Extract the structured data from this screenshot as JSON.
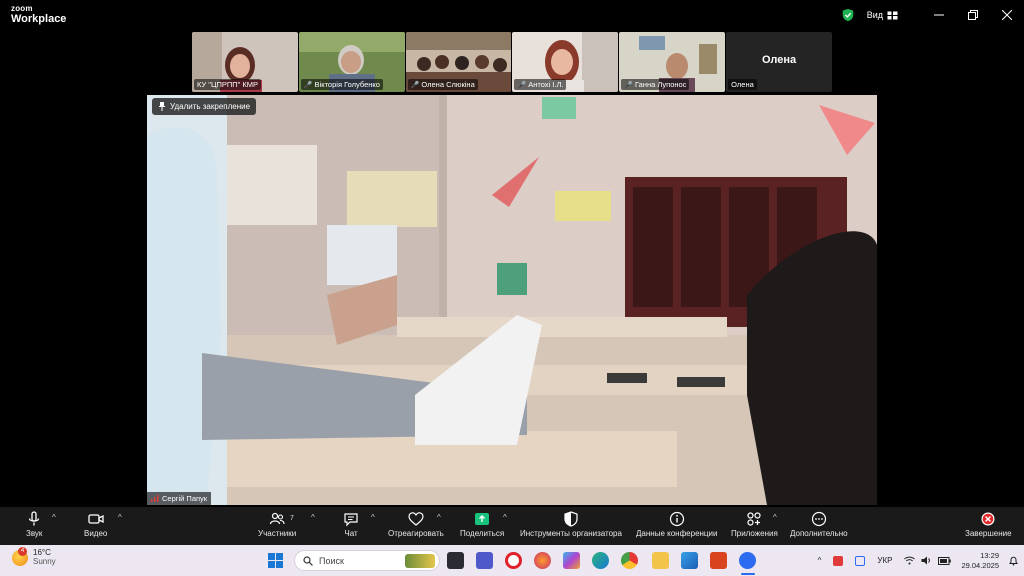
{
  "app": {
    "brand_small": "zoom",
    "brand_large": "Workplace"
  },
  "titlebar": {
    "view_label": "Вид"
  },
  "gallery": [
    {
      "name": "КУ \"ЦПРПП\" КМР",
      "muted": false
    },
    {
      "name": "Вікторія Голубенко",
      "muted": true
    },
    {
      "name": "Олена Слюкіна",
      "muted": true
    },
    {
      "name": "Антохі І.Л.",
      "muted": true
    },
    {
      "name": "Ганна Лупонос",
      "muted": true
    },
    {
      "name": "Олена",
      "muted": false,
      "big_label": "Олена"
    }
  ],
  "main": {
    "unpin_label": "Удалить закрепление",
    "speaker_name": "Сергій Папук"
  },
  "toolbar": {
    "audio": "Звук",
    "video": "Видео",
    "participants": "Участники",
    "participants_count": "7",
    "chat": "Чат",
    "react": "Отреагировать",
    "share": "Поделиться",
    "host_tools": "Инструменты организатора",
    "meeting_info": "Данные конференции",
    "apps": "Приложения",
    "more": "Дополнительно",
    "end": "Завершение"
  },
  "taskbar": {
    "weather_temp": "16°C",
    "weather_cond": "Sunny",
    "weather_badge": "4",
    "search_placeholder": "Поиск",
    "lang": "УКР",
    "time": "13:29",
    "date": "29.04.2025"
  },
  "colors": {
    "toolbar_bg": "#1a1a1a",
    "share_green": "#19c37d",
    "end_red": "#e02828",
    "taskbar_bg": "#ece7f0"
  }
}
